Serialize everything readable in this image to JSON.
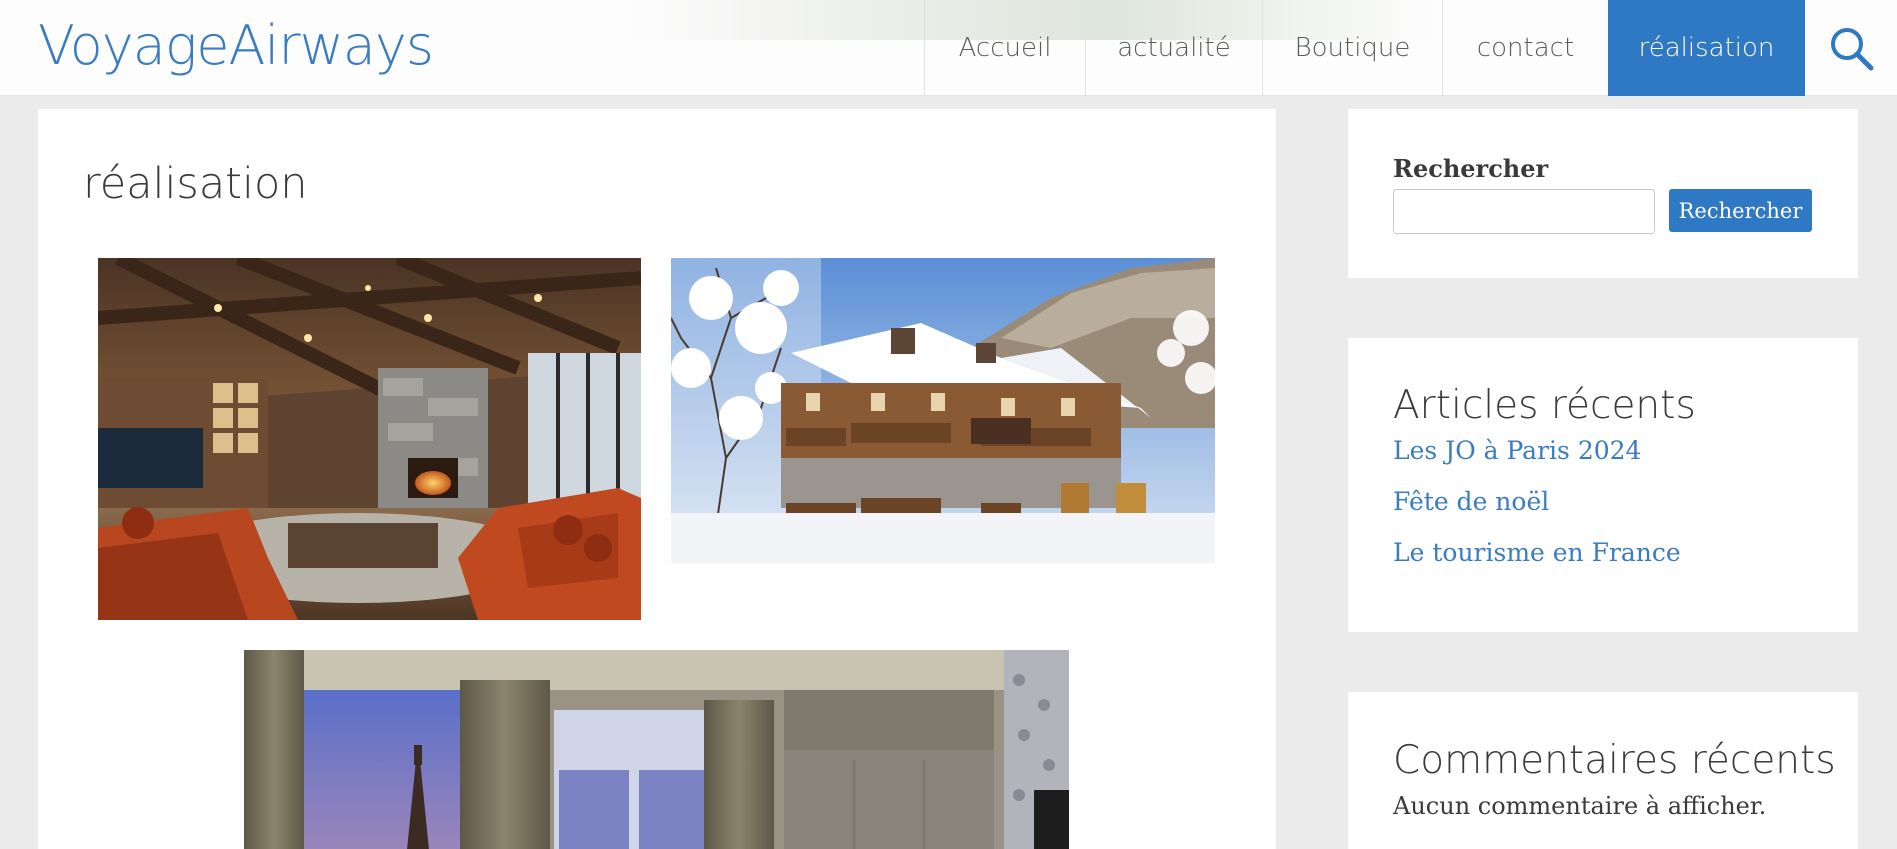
{
  "header": {
    "logo": "VoyageAirways",
    "nav": [
      {
        "label": "Accueil",
        "active": false
      },
      {
        "label": "actualité",
        "active": false
      },
      {
        "label": "Boutique",
        "active": false
      },
      {
        "label": "contact",
        "active": false
      },
      {
        "label": "réalisation",
        "active": true
      }
    ],
    "search_icon": "search-icon"
  },
  "main": {
    "title": "réalisation",
    "gallery": [
      {
        "name": "living-room-photo",
        "subject": "chalet living room with fireplace and orange sofas"
      },
      {
        "name": "snowy-chalet-photo",
        "subject": "wooden chalet covered in snow"
      },
      {
        "name": "paris-hotel-room-photo",
        "subject": "hotel room with window view of the Eiffel Tower"
      }
    ]
  },
  "sidebar": {
    "search": {
      "label": "Rechercher",
      "input_value": "",
      "placeholder": "",
      "button_label": "Rechercher"
    },
    "recent_posts": {
      "title": "Articles récents",
      "items": [
        "Les JO à Paris 2024",
        "Fête de noël",
        "Le tourisme en France"
      ]
    },
    "recent_comments": {
      "title": "Commentaires récents",
      "empty_text": "Aucun commentaire à afficher."
    }
  },
  "colors": {
    "accent": "#2f78c4",
    "link": "#3a7cc2",
    "background": "#ebebeb"
  }
}
